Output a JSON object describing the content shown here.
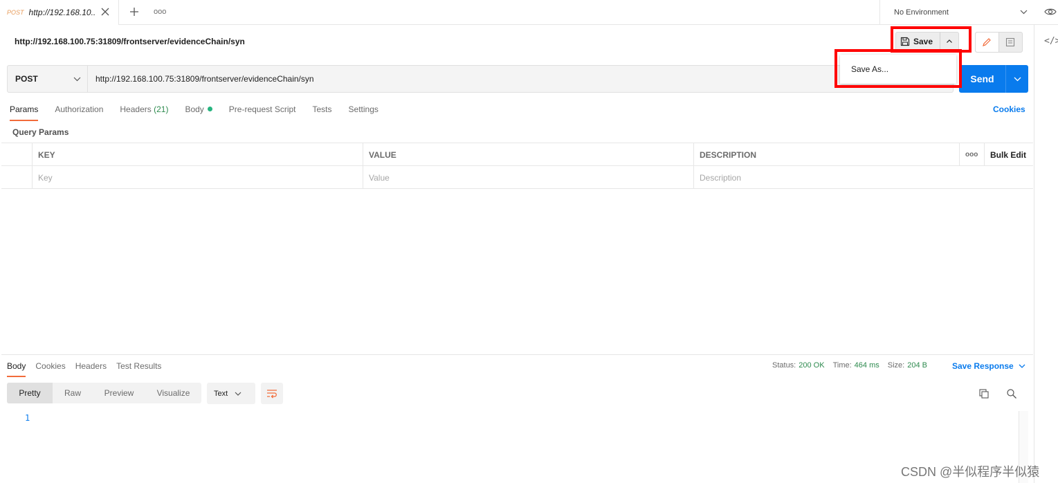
{
  "tabbar": {
    "tab_method": "POST",
    "tab_title": "http://192.168.10...",
    "more_label": "ooo",
    "environment": "No Environment"
  },
  "header": {
    "request_name": "http://192.168.100.75:31809/frontserver/evidenceChain/syn",
    "save_label": "Save",
    "save_as_label": "Save As..."
  },
  "request": {
    "method": "POST",
    "url": "http://192.168.100.75:31809/frontserver/evidenceChain/syn",
    "send_label": "Send"
  },
  "request_tabs": {
    "params": "Params",
    "authorization": "Authorization",
    "headers": "Headers",
    "headers_count": "(21)",
    "body": "Body",
    "prerequest": "Pre-request Script",
    "tests": "Tests",
    "settings": "Settings",
    "cookies": "Cookies"
  },
  "params": {
    "title": "Query Params",
    "columns": [
      "KEY",
      "VALUE",
      "DESCRIPTION"
    ],
    "more": "ooo",
    "bulk_edit": "Bulk Edit",
    "placeholders": [
      "Key",
      "Value",
      "Description"
    ]
  },
  "response": {
    "tabs": [
      "Body",
      "Cookies",
      "Headers",
      "Test Results"
    ],
    "status_label": "Status:",
    "status_value": "200 OK",
    "time_label": "Time:",
    "time_value": "464 ms",
    "size_label": "Size:",
    "size_value": "204 B",
    "save_response": "Save Response",
    "formats": [
      "Pretty",
      "Raw",
      "Preview",
      "Visualize"
    ],
    "text_type": "Text",
    "line_number": "1"
  },
  "watermark": "CSDN @半似程序半似猿",
  "colors": {
    "accent_blue": "#097bed",
    "tab_underline": "#f26b3a",
    "highlight_red": "#ff0000",
    "status_green": "#2d8a4e"
  }
}
